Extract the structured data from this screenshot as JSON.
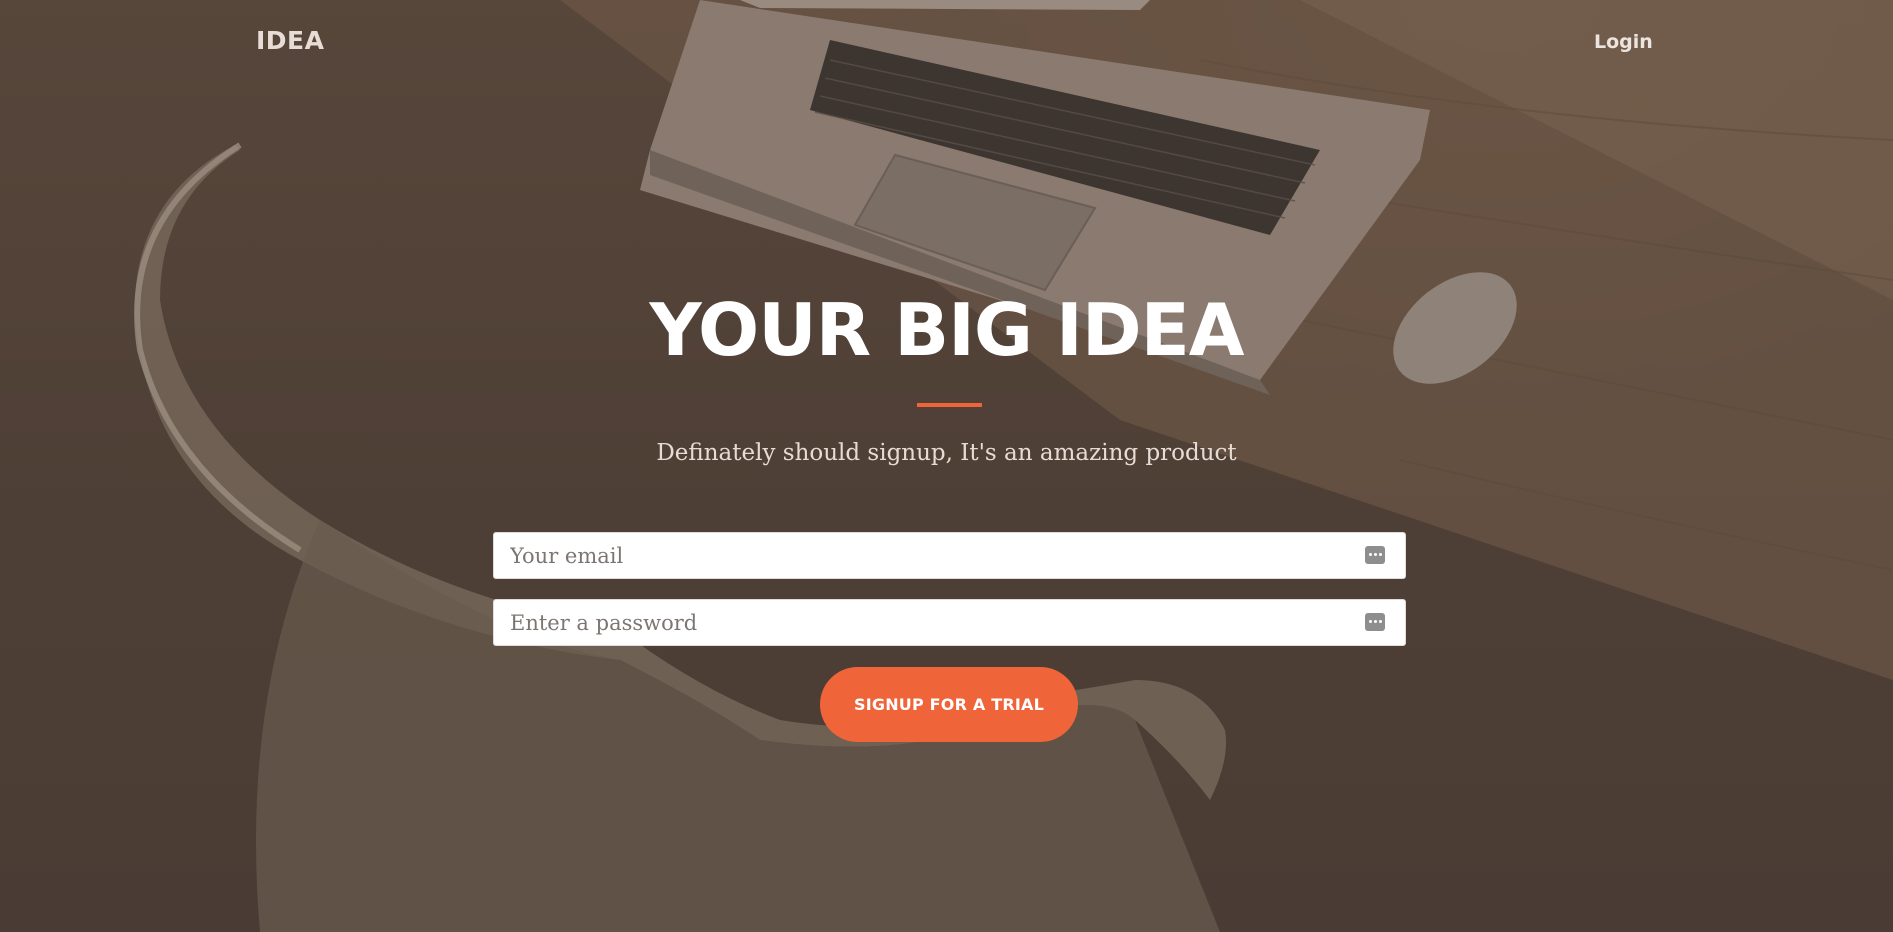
{
  "header": {
    "logo": "IDEA",
    "login_label": "Login"
  },
  "hero": {
    "title": "YOUR BIG IDEA",
    "subtitle": "Definately should signup, It's an amazing product"
  },
  "form": {
    "email_placeholder": "Your email",
    "email_value": "",
    "password_placeholder": "Enter a password",
    "password_value": "",
    "submit_label": "SIGNUP FOR A TRIAL"
  },
  "colors": {
    "accent": "#f0643a",
    "overlay": "#4f4037",
    "text_light": "#ffffff"
  },
  "icons": {
    "field_icon": "password-manager-key-icon",
    "background": "laptop-desk-photo"
  }
}
